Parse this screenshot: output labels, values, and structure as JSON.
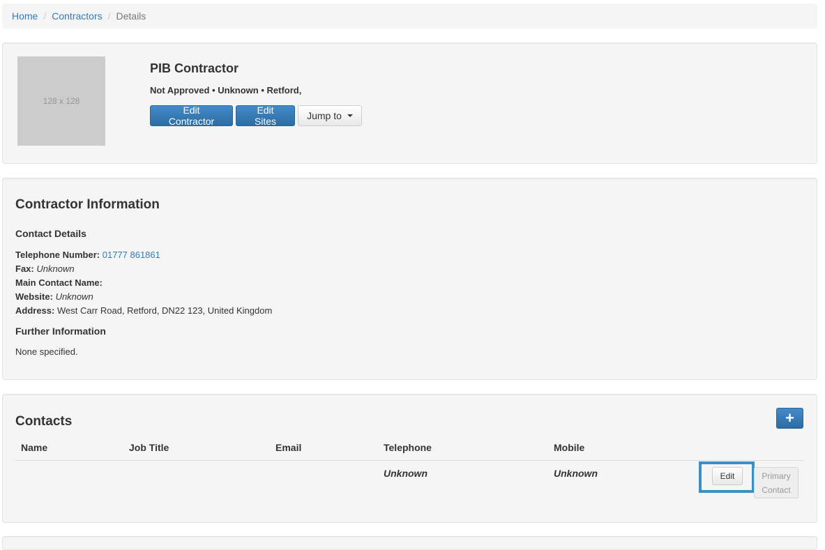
{
  "breadcrumb": {
    "items": [
      {
        "label": "Home"
      },
      {
        "label": "Contractors"
      }
    ],
    "separator": "/",
    "current": "Details"
  },
  "header": {
    "image_placeholder": "128 x 128",
    "title": "PIB Contractor",
    "subtitle": "Not Approved • Unknown • Retford,",
    "edit_contractor_label": "Edit Contractor",
    "edit_sites_label": "Edit Sites",
    "jump_to_label": "Jump to"
  },
  "info": {
    "title": "Contractor Information",
    "contact_details_heading": "Contact Details",
    "telephone_label": "Telephone Number:",
    "telephone_value": "01777 861861",
    "fax_label": "Fax:",
    "fax_value": "Unknown",
    "main_contact_label": "Main Contact Name:",
    "main_contact_value": "",
    "website_label": "Website:",
    "website_value": "Unknown",
    "address_label": "Address:",
    "address_value": "West Carr Road, Retford, DN22 123, United Kingdom",
    "further_heading": "Further Information",
    "further_value": "None specified."
  },
  "contacts": {
    "title": "Contacts",
    "add_label": "+",
    "columns": [
      "Name",
      "Job Title",
      "Email",
      "Telephone",
      "Mobile"
    ],
    "rows": [
      {
        "name": "",
        "job_title": "",
        "email": "",
        "telephone": "Unknown",
        "mobile": "Unknown",
        "edit_label": "Edit",
        "primary_line1": "Primary",
        "primary_line2": "Contact"
      }
    ]
  },
  "colors": {
    "link": "#337ab7",
    "primary": "#337ab7",
    "well": "#f5f5f5",
    "highlight": "#3a8fc7"
  }
}
